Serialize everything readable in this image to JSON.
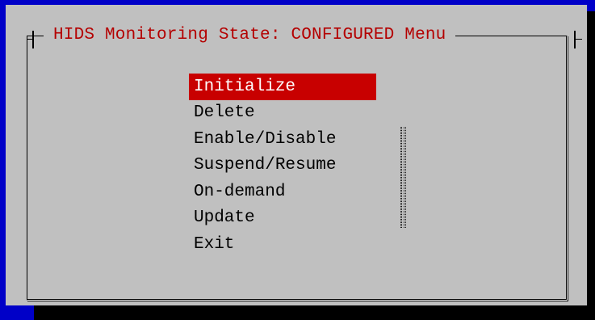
{
  "dialog": {
    "title": "HIDS Monitoring State: CONFIGURED Menu"
  },
  "menu": {
    "selected_index": 0,
    "items": [
      {
        "label": "Initialize"
      },
      {
        "label": "Delete"
      },
      {
        "label": "Enable/Disable"
      },
      {
        "label": "Suspend/Resume"
      },
      {
        "label": "On-demand"
      },
      {
        "label": "Update"
      },
      {
        "label": "Exit"
      }
    ]
  },
  "scroll": {
    "icon": "scroll-position-indicator"
  },
  "colors": {
    "screen_background": "#0000c8",
    "dialog_background": "#c0c0c0",
    "title_text": "#b40000",
    "selection_background": "#c80000",
    "selection_text": "#ffffff",
    "item_text": "#000000",
    "shadow": "#000000"
  }
}
